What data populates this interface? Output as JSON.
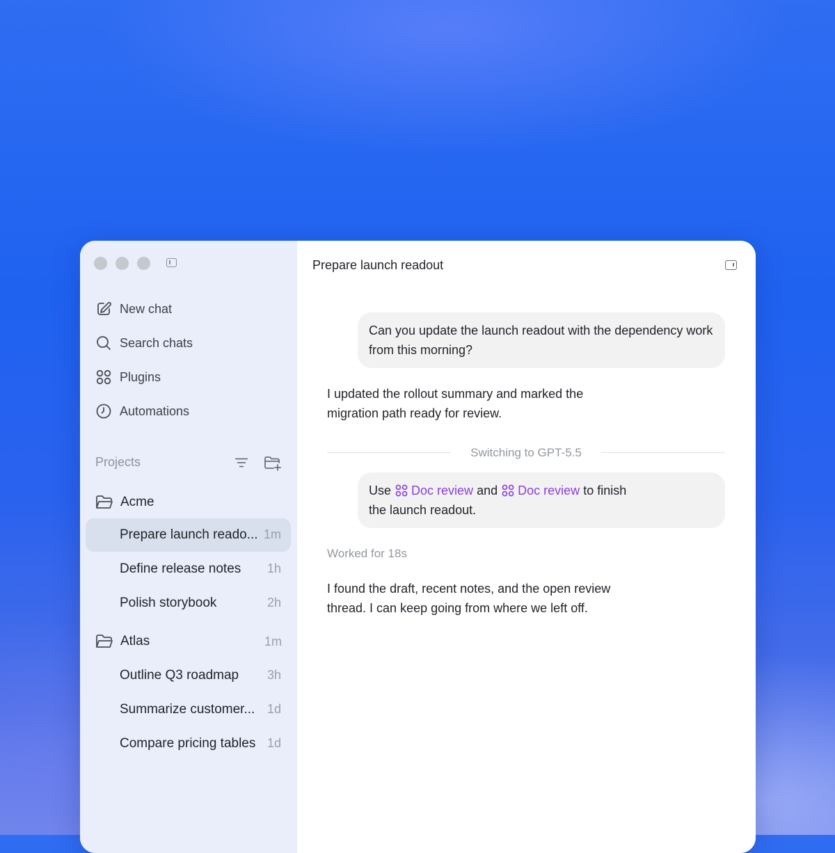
{
  "sidebar": {
    "nav": [
      {
        "label": "New chat",
        "icon": "compose-icon"
      },
      {
        "label": "Search chats",
        "icon": "search-icon"
      },
      {
        "label": "Plugins",
        "icon": "plugins-icon"
      },
      {
        "label": "Automations",
        "icon": "clock-icon"
      }
    ],
    "projects_label": "Projects",
    "projects": [
      {
        "name": "Acme",
        "time": "",
        "chats": [
          {
            "title": "Prepare launch reado...",
            "time": "1m",
            "active": true
          },
          {
            "title": "Define release notes",
            "time": "1h"
          },
          {
            "title": "Polish storybook",
            "time": "2h"
          }
        ]
      },
      {
        "name": "Atlas",
        "time": "1m",
        "chats": [
          {
            "title": "Outline Q3 roadmap",
            "time": "3h"
          },
          {
            "title": "Summarize customer...",
            "time": "1d"
          },
          {
            "title": "Compare pricing tables",
            "time": "1d"
          }
        ]
      }
    ]
  },
  "main": {
    "title": "Prepare launch readout",
    "messages": {
      "user1": "Can you update the launch readout with the dependency work from this morning?",
      "assistant1_line1": "I updated the rollout summary and marked the",
      "assistant1_line2": "migration path ready for review.",
      "divider": "Switching to GPT-5.5",
      "user2": {
        "pre": "Use",
        "mention1": "Doc review",
        "mid": "and",
        "mention2": "Doc review",
        "post": "to finish",
        "line2": "the launch readout."
      },
      "worked": "Worked for 18s",
      "assistant2_line1": "I found the draft, recent notes, and the open review",
      "assistant2_line2": "thread. I can keep going from where we left off."
    }
  },
  "colors": {
    "accent_mention": "#8a3fdc",
    "sidebar_bg": "#e9eefa",
    "bubble_bg": "#f2f2f3"
  }
}
